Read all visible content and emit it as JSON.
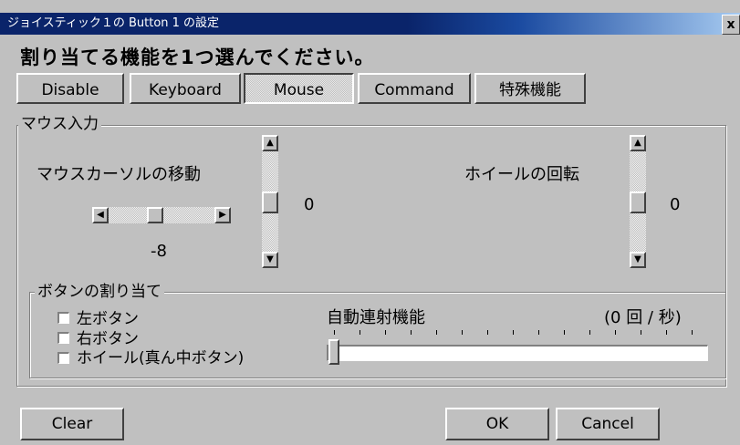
{
  "window": {
    "title": "ジョイスティック１の Button 1 の設定",
    "close_label": "x"
  },
  "instruction": "割り当てる機能を1つ選んでください。",
  "tabs": [
    {
      "label": "Disable",
      "selected": false
    },
    {
      "label": "Keyboard",
      "selected": false
    },
    {
      "label": "Mouse",
      "selected": true
    },
    {
      "label": "Command",
      "selected": false
    },
    {
      "label": "特殊機能",
      "selected": false
    }
  ],
  "mouse_input": {
    "legend": "マウス入力",
    "cursor_label": "マウスカーソルの移動",
    "cursor_x_value": "-8",
    "cursor_y_value": "0",
    "wheel_label": "ホイールの回転",
    "wheel_value": "0"
  },
  "button_assign": {
    "legend": "ボタンの割り当て",
    "left_button": "左ボタン",
    "right_button": "右ボタン",
    "wheel_button": "ホイール(真ん中ボタン)",
    "auto_fire_label": "自動連射機能",
    "auto_fire_rate": "(0 回 / 秒)"
  },
  "footer": {
    "clear_label": "Clear",
    "ok_label": "OK",
    "cancel_label": "Cancel"
  }
}
